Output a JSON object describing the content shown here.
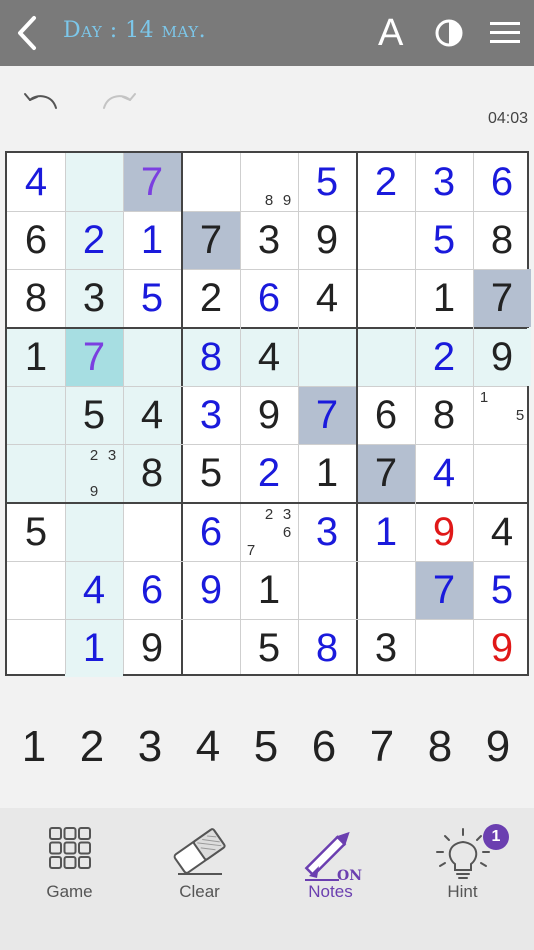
{
  "header": {
    "title": "Day : 14 may.",
    "font_label": "A"
  },
  "timer": "04:03",
  "colors": {
    "given": "#222222",
    "entered": "#1a1adc",
    "selected_val": "#7b3fe0",
    "error": "#e01818",
    "hl_row_col": "#e6f5f5",
    "hl_selected": "#a7dee2",
    "hl_same": "#b4bfd0"
  },
  "board": [
    [
      {
        "v": "4",
        "t": "e"
      },
      {
        "v": "",
        "t": "",
        "h": "rc"
      },
      {
        "v": "7",
        "t": "s",
        "h": "same"
      },
      {
        "v": "",
        "t": ""
      },
      {
        "v": "",
        "t": "",
        "notes": [
          "",
          "",
          "",
          "",
          "",
          "",
          "",
          "8",
          "9"
        ]
      },
      {
        "v": "5",
        "t": "e"
      },
      {
        "v": "2",
        "t": "e"
      },
      {
        "v": "3",
        "t": "e"
      },
      {
        "v": "6",
        "t": "e"
      }
    ],
    [
      {
        "v": "6",
        "t": "g"
      },
      {
        "v": "2",
        "t": "e",
        "h": "rc"
      },
      {
        "v": "1",
        "t": "e"
      },
      {
        "v": "7",
        "t": "g",
        "h": "same"
      },
      {
        "v": "3",
        "t": "g"
      },
      {
        "v": "9",
        "t": "g"
      },
      {
        "v": "",
        "t": ""
      },
      {
        "v": "5",
        "t": "e"
      },
      {
        "v": "8",
        "t": "g"
      }
    ],
    [
      {
        "v": "8",
        "t": "g"
      },
      {
        "v": "3",
        "t": "g",
        "h": "rc"
      },
      {
        "v": "5",
        "t": "e"
      },
      {
        "v": "2",
        "t": "g"
      },
      {
        "v": "6",
        "t": "e"
      },
      {
        "v": "4",
        "t": "g"
      },
      {
        "v": "",
        "t": ""
      },
      {
        "v": "1",
        "t": "g"
      },
      {
        "v": "7",
        "t": "g",
        "h": "same"
      }
    ],
    [
      {
        "v": "1",
        "t": "g",
        "h": "rc"
      },
      {
        "v": "7",
        "t": "s",
        "h": "sel"
      },
      {
        "v": "",
        "t": "",
        "h": "rc"
      },
      {
        "v": "8",
        "t": "e",
        "h": "rc"
      },
      {
        "v": "4",
        "t": "g",
        "h": "rc"
      },
      {
        "v": "",
        "t": "",
        "h": "rc"
      },
      {
        "v": "",
        "t": "",
        "h": "rc"
      },
      {
        "v": "2",
        "t": "e",
        "h": "rc"
      },
      {
        "v": "9",
        "t": "g",
        "h": "rc"
      }
    ],
    [
      {
        "v": "",
        "t": "",
        "h": "rc"
      },
      {
        "v": "5",
        "t": "g",
        "h": "rc"
      },
      {
        "v": "4",
        "t": "g",
        "h": "rc"
      },
      {
        "v": "3",
        "t": "e"
      },
      {
        "v": "9",
        "t": "g"
      },
      {
        "v": "7",
        "t": "e",
        "h": "same"
      },
      {
        "v": "6",
        "t": "g"
      },
      {
        "v": "8",
        "t": "g"
      },
      {
        "v": "",
        "t": "",
        "notes": [
          "1",
          "",
          "",
          "",
          "",
          "5",
          "",
          "",
          ""
        ]
      }
    ],
    [
      {
        "v": "",
        "t": "",
        "h": "rc"
      },
      {
        "v": "",
        "t": "",
        "h": "rc",
        "notes": [
          "",
          "2",
          "3",
          "",
          "",
          "",
          "",
          "9",
          ""
        ]
      },
      {
        "v": "8",
        "t": "g",
        "h": "rc"
      },
      {
        "v": "5",
        "t": "g"
      },
      {
        "v": "2",
        "t": "e"
      },
      {
        "v": "1",
        "t": "g"
      },
      {
        "v": "7",
        "t": "g",
        "h": "same"
      },
      {
        "v": "4",
        "t": "e"
      },
      {
        "v": "",
        "t": ""
      }
    ],
    [
      {
        "v": "5",
        "t": "g"
      },
      {
        "v": "",
        "t": "",
        "h": "rc"
      },
      {
        "v": "",
        "t": ""
      },
      {
        "v": "6",
        "t": "e"
      },
      {
        "v": "",
        "t": "",
        "notes": [
          "",
          "2",
          "3",
          "",
          "",
          "6",
          "7",
          "",
          ""
        ]
      },
      {
        "v": "3",
        "t": "e"
      },
      {
        "v": "1",
        "t": "e"
      },
      {
        "v": "9",
        "t": "x"
      },
      {
        "v": "4",
        "t": "g"
      }
    ],
    [
      {
        "v": "",
        "t": ""
      },
      {
        "v": "4",
        "t": "e",
        "h": "rc"
      },
      {
        "v": "6",
        "t": "e"
      },
      {
        "v": "9",
        "t": "e"
      },
      {
        "v": "1",
        "t": "g"
      },
      {
        "v": "",
        "t": ""
      },
      {
        "v": "",
        "t": ""
      },
      {
        "v": "7",
        "t": "e",
        "h": "same"
      },
      {
        "v": "5",
        "t": "e"
      }
    ],
    [
      {
        "v": "",
        "t": ""
      },
      {
        "v": "1",
        "t": "e",
        "h": "rc"
      },
      {
        "v": "9",
        "t": "g"
      },
      {
        "v": "",
        "t": ""
      },
      {
        "v": "5",
        "t": "g"
      },
      {
        "v": "8",
        "t": "e"
      },
      {
        "v": "3",
        "t": "g"
      },
      {
        "v": "",
        "t": ""
      },
      {
        "v": "9",
        "t": "x"
      }
    ]
  ],
  "numpad": [
    "1",
    "2",
    "3",
    "4",
    "5",
    "6",
    "7",
    "8",
    "9"
  ],
  "tools": [
    {
      "name": "game",
      "label": "Game"
    },
    {
      "name": "clear",
      "label": "Clear"
    },
    {
      "name": "notes",
      "label": "Notes",
      "state": "ON"
    },
    {
      "name": "hint",
      "label": "Hint",
      "badge": "1"
    }
  ]
}
